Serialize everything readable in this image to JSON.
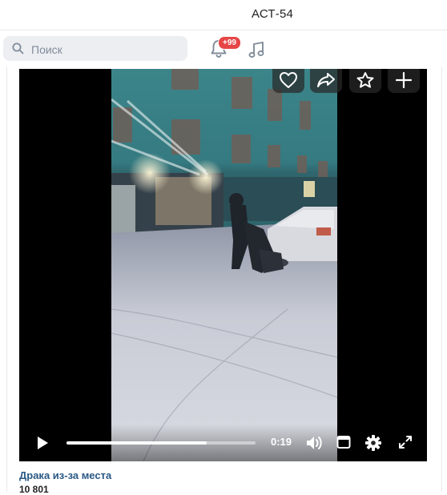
{
  "window": {
    "title": "АСТ-54"
  },
  "search": {
    "placeholder": "Поиск"
  },
  "notifications": {
    "badge": "+99"
  },
  "video": {
    "title": "Драка из-за места",
    "views": "10 801",
    "time": "0:19",
    "progress": 0.74
  },
  "icons": {
    "search": "search-icon",
    "bell": "bell-icon",
    "music": "music-note-icon",
    "like": "heart-icon",
    "share": "share-arrow-icon",
    "favorite": "star-icon",
    "add": "plus-icon",
    "play": "play-icon",
    "volume": "volume-icon",
    "miniplayer": "picture-in-picture-icon",
    "settings": "gear-icon",
    "fullscreen": "fullscreen-icon"
  },
  "colors": {
    "accent": "#2a5885",
    "badge": "#e64646",
    "search_bg": "#eceef2"
  }
}
